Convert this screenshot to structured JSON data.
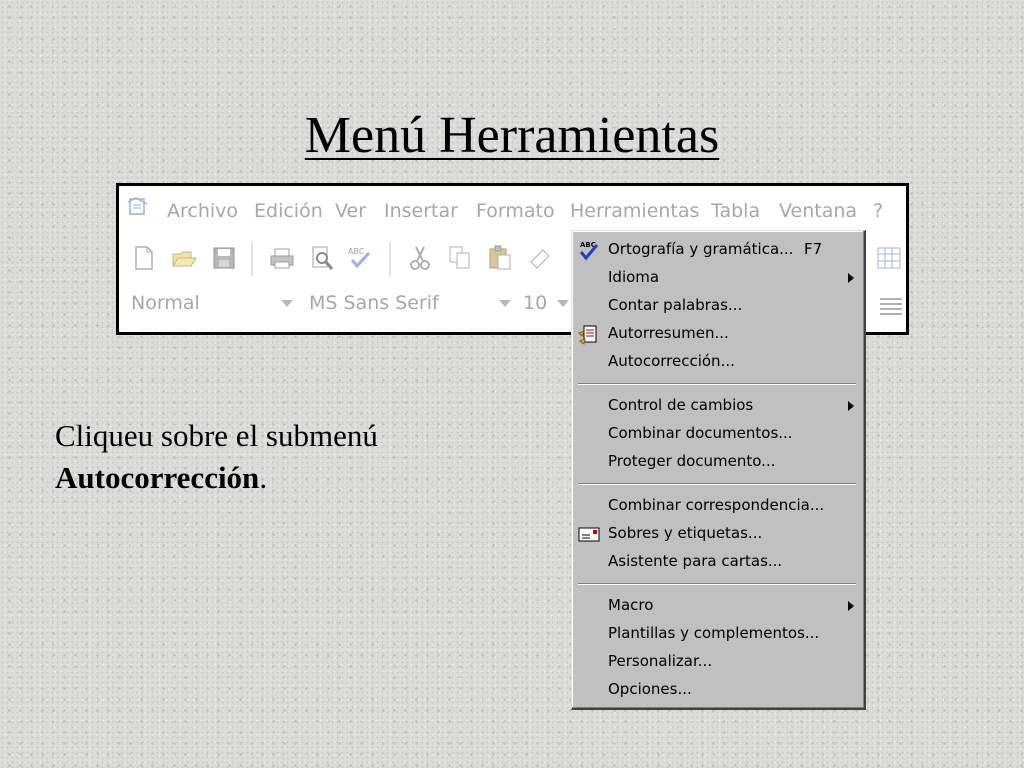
{
  "slide": {
    "title": "Menú Herramientas",
    "instruction_line1": "Cliqueu sobre el submenú",
    "instruction_em": "Autocorrección",
    "instruction_end": "."
  },
  "word": {
    "menubar": [
      "Archivo",
      "Edición",
      "Ver",
      "Insertar",
      "Formato",
      "Herramientas",
      "Tabla",
      "Ventana",
      "?"
    ],
    "style_value": "Normal",
    "font_value": "MS Sans Serif",
    "size_value": "10"
  },
  "dropdown": {
    "items": [
      {
        "label": "Ortografía y gramática...",
        "shortcut": "F7",
        "icon": "spellcheck-icon"
      },
      {
        "label": "Idioma",
        "submenu": true
      },
      {
        "label": "Contar palabras..."
      },
      {
        "label": "Autorresumen...",
        "icon": "autosummarize-icon"
      },
      {
        "label": "Autocorrección..."
      },
      {
        "label": "Control de cambios",
        "submenu": true
      },
      {
        "label": "Combinar documentos..."
      },
      {
        "label": "Proteger documento..."
      },
      {
        "label": "Combinar correspondencia..."
      },
      {
        "label": "Sobres y etiquetas...",
        "icon": "envelope-icon"
      },
      {
        "label": "Asistente para cartas..."
      },
      {
        "label": "Macro",
        "submenu": true
      },
      {
        "label": "Plantillas y complementos..."
      },
      {
        "label": "Personalizar..."
      },
      {
        "label": "Opciones..."
      }
    ]
  },
  "colors": {
    "faded_ui_text": "#a7a7a7",
    "menu_bg": "#c0c0c0"
  }
}
